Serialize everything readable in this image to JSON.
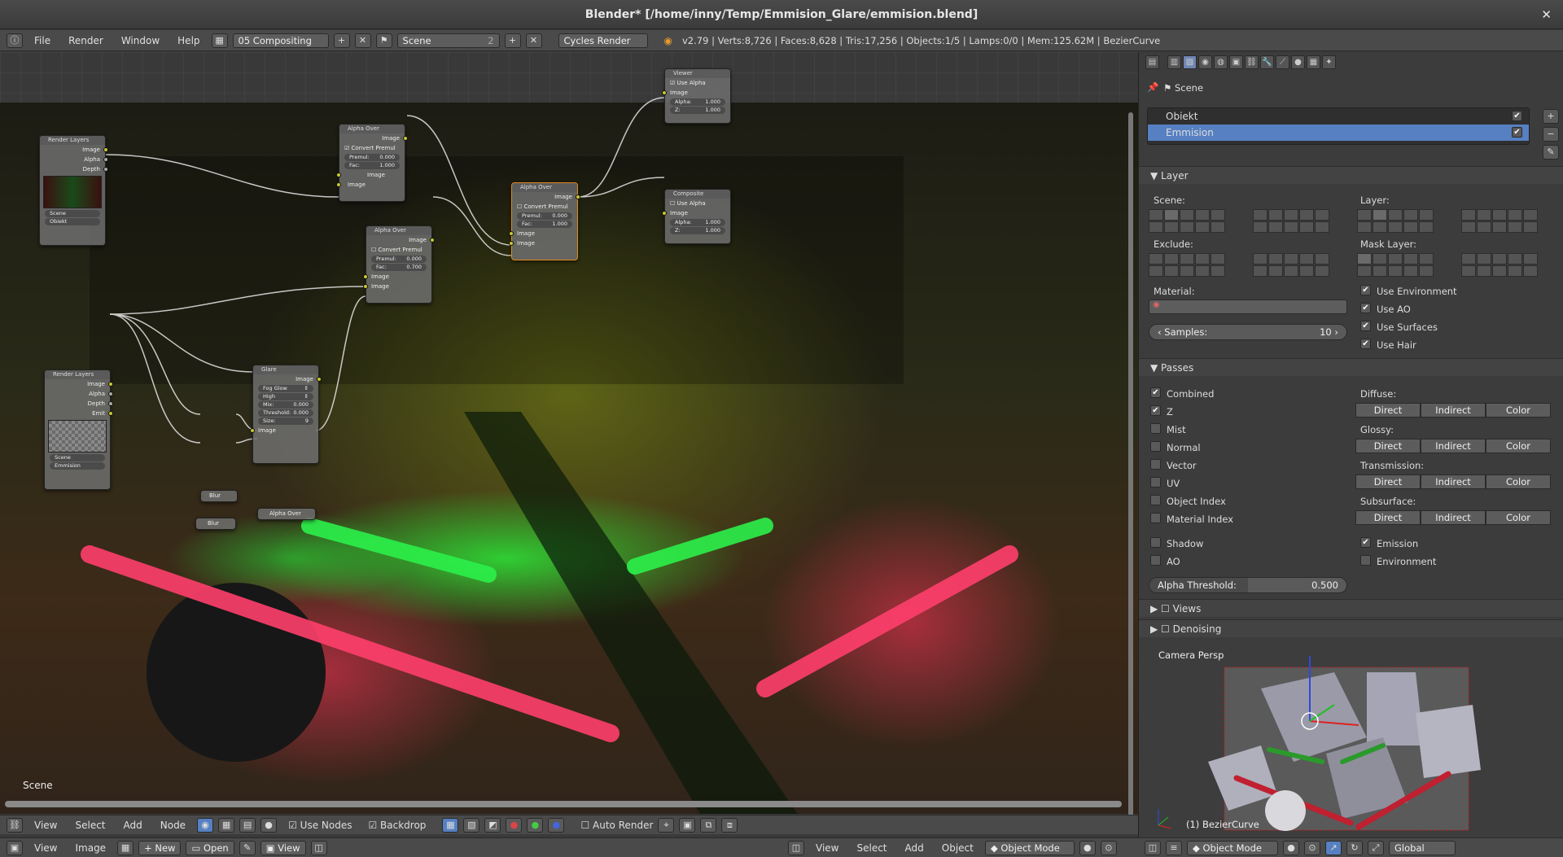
{
  "window": {
    "title": "Blender* [/home/inny/Temp/Emmision_Glare/emmision.blend]",
    "close": "✕"
  },
  "topbar": {
    "menus": [
      "File",
      "Render",
      "Window",
      "Help"
    ],
    "screen_layout": "05 Compositing",
    "scene": "Scene",
    "scene_users": "2",
    "engine": "Cycles Render",
    "stats": "v2.79 | Verts:8,726 | Faces:8,628 | Tris:17,256 | Objects:1/5 | Lamps:0/0 | Mem:125.62M | BezierCurve"
  },
  "node_editor": {
    "scene_label": "Scene",
    "nodes": {
      "render_layers_1": {
        "title": "Render Layers",
        "outputs": [
          "Image",
          "Alpha",
          "Depth"
        ],
        "scene": "Scene",
        "layer": "Obiekt"
      },
      "render_layers_2": {
        "title": "Render Layers",
        "outputs": [
          "Image",
          "Alpha",
          "Depth",
          "Emit"
        ],
        "scene": "Scene",
        "layer": "Emmision"
      },
      "alpha_over_1": {
        "title": "Alpha Over",
        "output": "Image",
        "convert_premul": "Convert Premul",
        "premul_label": "Premul:",
        "premul": "0.000",
        "fac_label": "Fac:",
        "fac": "1.000",
        "in1": "Image",
        "in2": "Image"
      },
      "alpha_over_2": {
        "title": "Alpha Over",
        "output": "Image",
        "convert_premul": "Convert Premul",
        "premul_label": "Premul:",
        "premul": "0.000",
        "fac_label": "Fac:",
        "fac": "0.700",
        "in1": "Image",
        "in2": "Image"
      },
      "alpha_over_3": {
        "title": "Alpha Over",
        "output": "Image",
        "convert_premul": "Convert Premul",
        "premul_label": "Premul:",
        "premul": "0.000",
        "fac_label": "Fac:",
        "fac": "1.000",
        "in1": "Image",
        "in2": "Image"
      },
      "alpha_over_4": {
        "title": "Alpha Over"
      },
      "glare": {
        "title": "Glare",
        "output": "Image",
        "type": "Fog Glow",
        "quality": "High",
        "mix_label": "Mix:",
        "mix": "0.000",
        "threshold_label": "Threshold:",
        "threshold": "0.000",
        "size_label": "Size:",
        "size": "9",
        "input": "Image"
      },
      "viewer": {
        "title": "Viewer",
        "use_alpha": "Use Alpha",
        "input": "Image",
        "alpha_label": "Alpha:",
        "alpha": "1.000",
        "z_label": "Z:",
        "z": "1.000"
      },
      "composite": {
        "title": "Composite",
        "use_alpha": "Use Alpha",
        "input": "Image",
        "alpha_label": "Alpha:",
        "alpha": "1.000",
        "z_label": "Z:",
        "z": "1.000"
      },
      "blur_1": {
        "title": "Blur"
      },
      "blur_2": {
        "title": "Blur"
      }
    },
    "header": {
      "menus": [
        "View",
        "Select",
        "Add",
        "Node"
      ],
      "use_nodes": "Use Nodes",
      "backdrop": "Backdrop",
      "auto_render": "Auto Render"
    }
  },
  "image_header": {
    "menus": [
      "View",
      "Image"
    ],
    "new": "New",
    "open": "Open",
    "view": "View"
  },
  "view3d_header": {
    "menus": [
      "View",
      "Select",
      "Add",
      "Object"
    ],
    "mode": "Object Mode"
  },
  "properties": {
    "breadcrumb": "Scene",
    "render_layers": [
      {
        "name": "Obiekt",
        "enabled": true
      },
      {
        "name": "Emmision",
        "enabled": true,
        "selected": true
      }
    ],
    "layer_panel": {
      "title": "Layer",
      "scene_label": "Scene:",
      "layer_label": "Layer:",
      "exclude_label": "Exclude:",
      "mask_layer_label": "Mask Layer:",
      "material_label": "Material:",
      "samples_label": "Samples:",
      "samples": "10",
      "use_environment": "Use Environment",
      "use_ao": "Use AO",
      "use_surfaces": "Use Surfaces",
      "use_hair": "Use Hair"
    },
    "passes_panel": {
      "title": "Passes",
      "left": [
        {
          "label": "Combined",
          "on": true
        },
        {
          "label": "Z",
          "on": true
        },
        {
          "label": "Mist",
          "on": false
        },
        {
          "label": "Normal",
          "on": false
        },
        {
          "label": "Vector",
          "on": false
        },
        {
          "label": "UV",
          "on": false
        },
        {
          "label": "Object Index",
          "on": false
        },
        {
          "label": "Material Index",
          "on": false
        }
      ],
      "groups": [
        "Diffuse:",
        "Glossy:",
        "Transmission:",
        "Subsurface:"
      ],
      "buttons": [
        "Direct",
        "Indirect",
        "Color"
      ],
      "shadow": "Shadow",
      "ao": "AO",
      "emission": "Emission",
      "environment": "Environment",
      "alpha_threshold_label": "Alpha Threshold:",
      "alpha_threshold": "0.500",
      "alpha_threshold_fraction": 0.5
    },
    "views_panel": "Views",
    "denoising_panel": "Denoising"
  },
  "viewport": {
    "label": "Camera Persp",
    "object_label": "(1) BezierCurve",
    "mode": "Object Mode",
    "orientation": "Global"
  },
  "colors": {
    "accent": "#5680c2",
    "selected_node": "#e08a1c",
    "socket": "#c8c82c"
  }
}
